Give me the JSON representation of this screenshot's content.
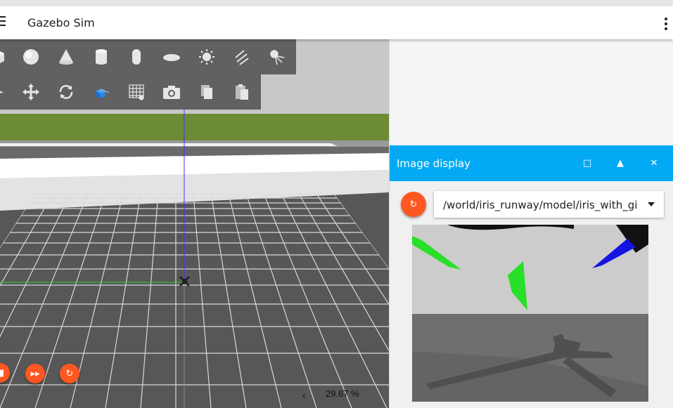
{
  "app": {
    "title": "Gazebo Sim"
  },
  "toolbar_shapes": [
    {
      "name": "box-icon"
    },
    {
      "name": "sphere-icon"
    },
    {
      "name": "cone-icon"
    },
    {
      "name": "cylinder-icon"
    },
    {
      "name": "capsule-icon"
    },
    {
      "name": "ellipsoid-icon"
    },
    {
      "name": "sun-light-icon"
    },
    {
      "name": "directional-light-icon"
    },
    {
      "name": "spot-light-icon"
    }
  ],
  "toolbar_tools": [
    {
      "name": "select-icon"
    },
    {
      "name": "translate-icon"
    },
    {
      "name": "rotate-icon"
    },
    {
      "name": "transform-control-icon"
    },
    {
      "name": "grid-config-icon"
    },
    {
      "name": "screenshot-icon"
    },
    {
      "name": "copy-icon"
    },
    {
      "name": "paste-icon"
    }
  ],
  "playback": {
    "stop": "■",
    "step": "▸▸",
    "reset": "↻"
  },
  "stats": {
    "arrow": "‹",
    "rtf": "29.67 %"
  },
  "image_display": {
    "title": "Image display",
    "maximize": "□",
    "collapse": "▲",
    "close": "✕",
    "refresh": "↻",
    "topic": "/world/iris_runway/model/iris_with_gimbal"
  },
  "colors": {
    "accent": "#03a9f4",
    "fab": "#ff5722",
    "toolbar": "#616161"
  }
}
